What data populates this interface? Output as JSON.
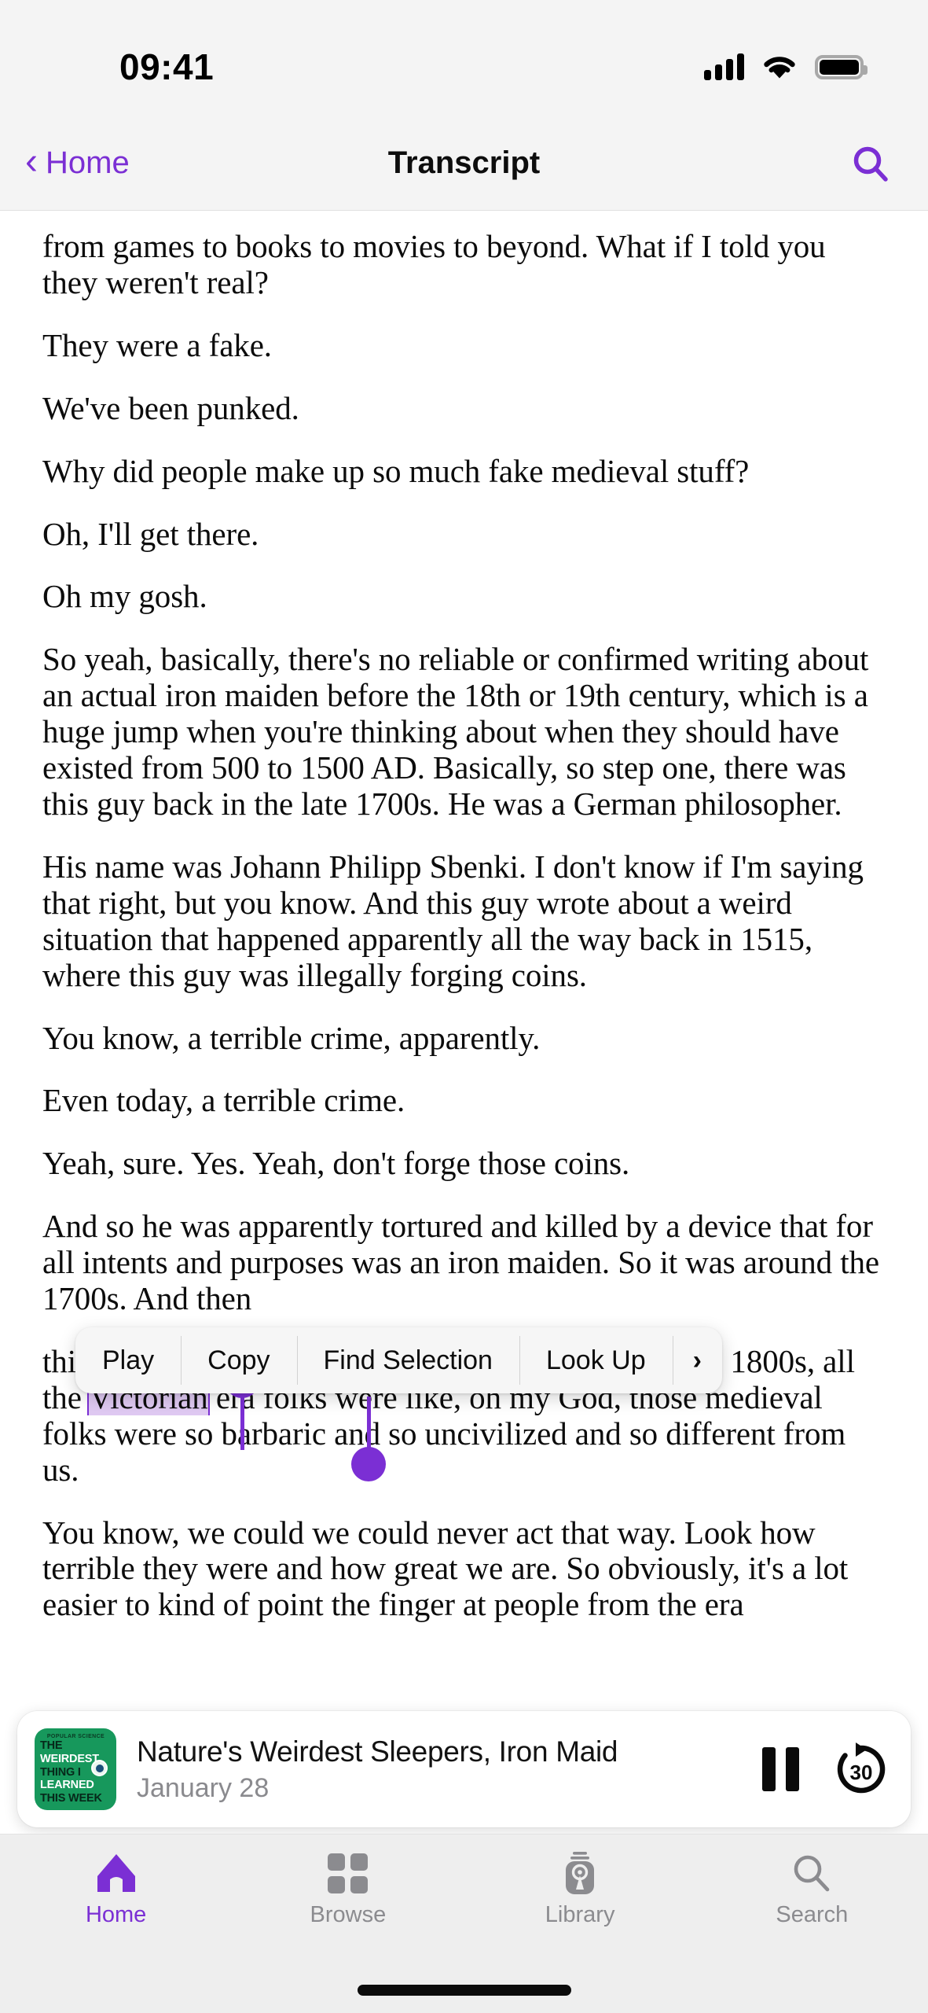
{
  "status_bar": {
    "time": "09:41",
    "signal_icon": "cellular-bars-icon",
    "wifi_icon": "wifi-icon",
    "battery_icon": "battery-full-icon"
  },
  "nav_bar": {
    "back_label": "Home",
    "back_chevron": "‹",
    "title": "Transcript",
    "search_icon": "search-icon",
    "accent_color": "#7B2FD4"
  },
  "transcript": {
    "paragraphs": [
      "from games to books to movies to beyond. What if I told you they weren't real?",
      "They were a fake.",
      "We've been punked.",
      "Why did people make up so much fake medieval stuff?",
      "Oh, I'll get there.",
      "Oh my gosh.",
      "So yeah, basically, there's no reliable or confirmed writing about an actual iron maiden before the 18th or 19th century, which is a huge jump when you're thinking about when they should have existed from 500 to 1500 AD. Basically, so step one, there was this guy back in the late 1700s. He was a German philosopher.",
      "His name was Johann Philipp Sbenki. I don't know if I'm saying that right, but you know. And this guy wrote about a weird situation that happened apparently all the way back in 1515, where this guy was illegally forging coins.",
      "You know, a terrible crime, apparently.",
      "Even today, a terrible crime.",
      "Yeah, sure. Yes. Yeah, don't forge those coins.",
      "And so he was apparently tortured and killed by a device that for all intents and purposes was an iron maiden. So it was around the 1700s. And then",
      "You know, we could we could never act that way. Look how terrible they were and how great we are. So obviously, it's a lot easier to kind of point the finger at people from the era"
    ],
    "selected_paragraph": {
      "before": "this piece of writing started circulating later on in the 1800s, all the ",
      "selection": "Victorian",
      "after": " era folks were like, oh my God, those medieval folks were so barbaric and so uncivilized and so different from us."
    },
    "selection_highlight_color": "#dfc9f2",
    "selection_handle_color": "#7B2FD4"
  },
  "context_menu": {
    "items": [
      {
        "label": "Play",
        "name": "play"
      },
      {
        "label": "Copy",
        "name": "copy"
      },
      {
        "label": "Find Selection",
        "name": "find-selection"
      },
      {
        "label": "Look Up",
        "name": "look-up"
      },
      {
        "label": "›",
        "name": "more"
      }
    ]
  },
  "mini_player": {
    "artwork": {
      "brand": "POPULAR SCIENCE",
      "line1": "THE",
      "line2": "WEIRDEST",
      "line3": "THING I",
      "line4": "LEARNED",
      "line5": "THIS WEEK",
      "background_color": "#17985C",
      "eye_icon": "eyeball-icon"
    },
    "title": "Nature's Weirdest Sleepers, Iron Maid",
    "date": "January 28",
    "pause_icon": "pause-icon",
    "skip_label": "30",
    "skip_icon": "skip-forward-30-icon"
  },
  "tab_bar": {
    "tabs": [
      {
        "label": "Home",
        "icon": "home-icon",
        "active": true
      },
      {
        "label": "Browse",
        "icon": "grid-icon",
        "active": false
      },
      {
        "label": "Library",
        "icon": "library-podcast-icon",
        "active": false
      },
      {
        "label": "Search",
        "icon": "search-icon",
        "active": false
      }
    ],
    "home_indicator": "home-indicator"
  }
}
